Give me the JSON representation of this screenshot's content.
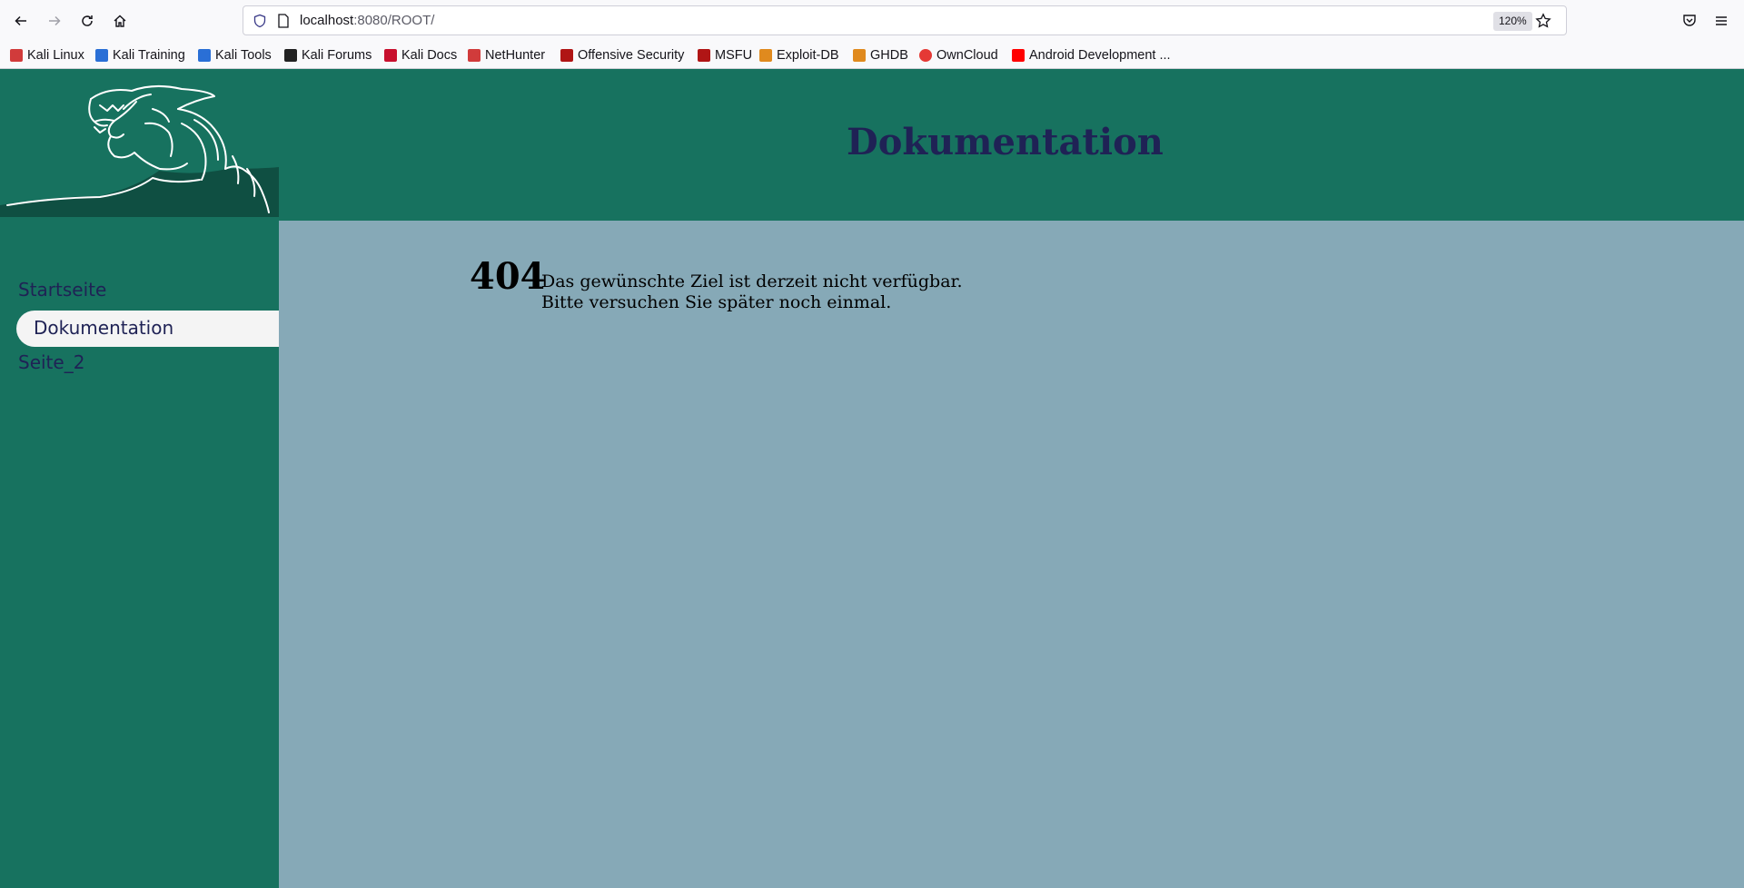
{
  "browser": {
    "url_host": "localhost",
    "url_rest": ":8080/ROOT/",
    "zoom": "120%",
    "bookmarks": [
      {
        "label": "Kali Linux",
        "color": "#d13b3b"
      },
      {
        "label": "Kali Training",
        "color": "#2a6fd6"
      },
      {
        "label": "Kali Tools",
        "color": "#2a6fd6"
      },
      {
        "label": "Kali Forums",
        "color": "#222222"
      },
      {
        "label": "Kali Docs",
        "color": "#c8102e"
      },
      {
        "label": "NetHunter",
        "color": "#d13b3b"
      },
      {
        "label": "Offensive Security",
        "color": "#b01515"
      },
      {
        "label": "MSFU",
        "color": "#b01515"
      },
      {
        "label": "Exploit-DB",
        "color": "#e08a1e"
      },
      {
        "label": "GHDB",
        "color": "#e08a1e"
      },
      {
        "label": "OwnCloud",
        "color": "#e53935"
      },
      {
        "label": "Android Development ...",
        "color": "#ff0000"
      }
    ]
  },
  "site": {
    "title": "Dokumentation",
    "nav": {
      "startseite": "Startseite",
      "dokumentation": "Dokumentation",
      "seite2": "Seite_2"
    },
    "error": {
      "code": "404",
      "line1": "Das gewünschte Ziel ist derzeit nicht verfügbar.",
      "line2": "Bitte versuchen Sie später noch einmal."
    }
  },
  "colors": {
    "header_bg": "#17725f",
    "main_bg": "#86a9b7",
    "title_color": "#1f2255"
  }
}
